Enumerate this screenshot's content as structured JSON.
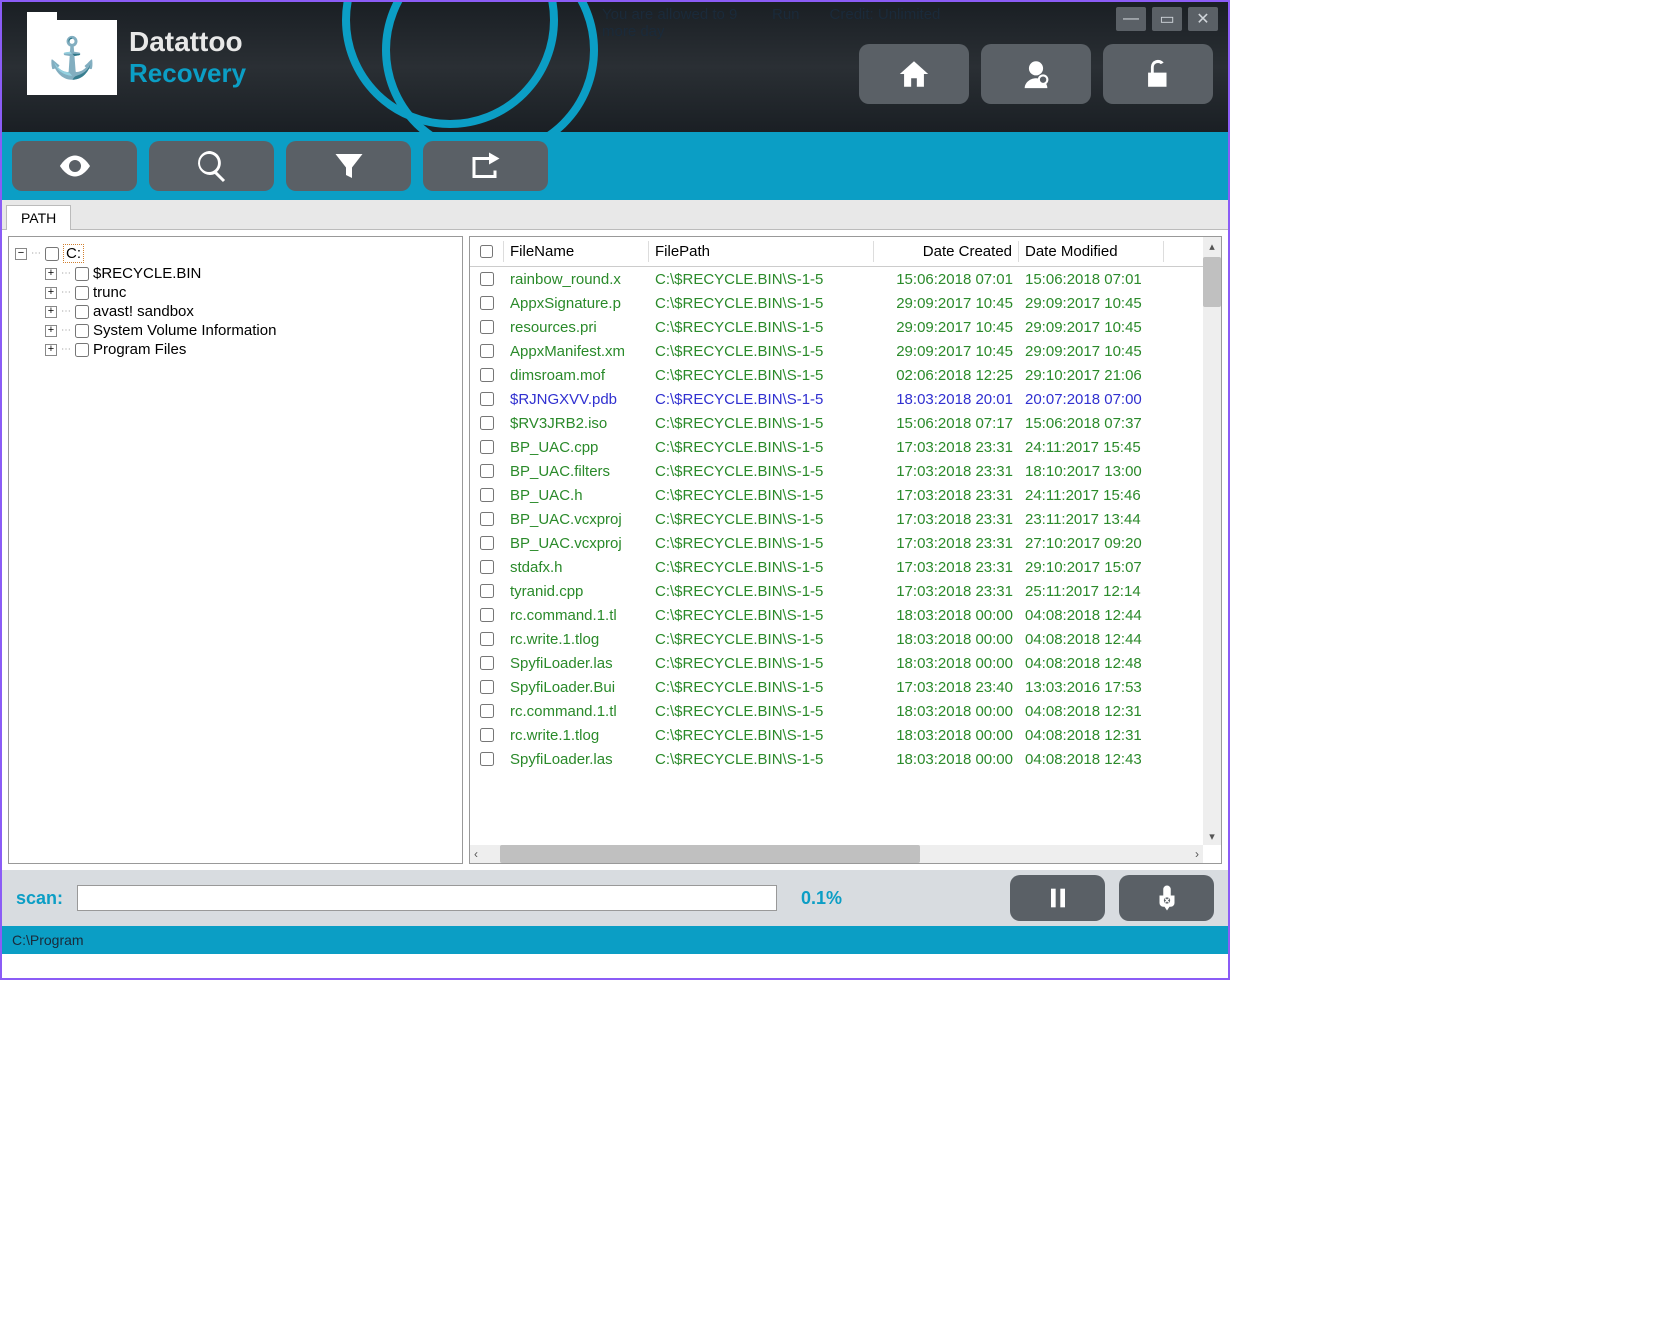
{
  "app": {
    "title1": "Datattoo",
    "title2": "Recovery"
  },
  "top_info": {
    "trial": "You are allowed to 9 more day",
    "run": "Run",
    "credit": "Credit: Unlimited"
  },
  "tab": {
    "label": "PATH"
  },
  "tree": {
    "root": "C:",
    "children": [
      "$RECYCLE.BIN",
      "trunc",
      "avast! sandbox",
      "System Volume Information",
      "Program Files"
    ]
  },
  "columns": {
    "filename": "FileName",
    "filepath": "FilePath",
    "created": "Date Created",
    "modified": "Date Modified"
  },
  "rows": [
    {
      "fn": "rainbow_round.x",
      "fp": "C:\\$RECYCLE.BIN\\S-1-5",
      "dc": "15:06:2018 07:01",
      "dm": "15:06:2018 07:01",
      "style": "green"
    },
    {
      "fn": "AppxSignature.p",
      "fp": "C:\\$RECYCLE.BIN\\S-1-5",
      "dc": "29:09:2017 10:45",
      "dm": "29:09:2017 10:45",
      "style": "green"
    },
    {
      "fn": "resources.pri",
      "fp": "C:\\$RECYCLE.BIN\\S-1-5",
      "dc": "29:09:2017 10:45",
      "dm": "29:09:2017 10:45",
      "style": "green"
    },
    {
      "fn": "AppxManifest.xm",
      "fp": "C:\\$RECYCLE.BIN\\S-1-5",
      "dc": "29:09:2017 10:45",
      "dm": "29:09:2017 10:45",
      "style": "green"
    },
    {
      "fn": "dimsroam.mof",
      "fp": "C:\\$RECYCLE.BIN\\S-1-5",
      "dc": "02:06:2018 12:25",
      "dm": "29:10:2017 21:06",
      "style": "green"
    },
    {
      "fn": "$RJNGXVV.pdb",
      "fp": "C:\\$RECYCLE.BIN\\S-1-5",
      "dc": "18:03:2018 20:01",
      "dm": "20:07:2018 07:00",
      "style": "blue"
    },
    {
      "fn": "$RV3JRB2.iso",
      "fp": "C:\\$RECYCLE.BIN\\S-1-5",
      "dc": "15:06:2018 07:17",
      "dm": "15:06:2018 07:37",
      "style": "green"
    },
    {
      "fn": "BP_UAC.cpp",
      "fp": "C:\\$RECYCLE.BIN\\S-1-5",
      "dc": "17:03:2018 23:31",
      "dm": "24:11:2017 15:45",
      "style": "green"
    },
    {
      "fn": "BP_UAC.filters",
      "fp": "C:\\$RECYCLE.BIN\\S-1-5",
      "dc": "17:03:2018 23:31",
      "dm": "18:10:2017 13:00",
      "style": "green"
    },
    {
      "fn": "BP_UAC.h",
      "fp": "C:\\$RECYCLE.BIN\\S-1-5",
      "dc": "17:03:2018 23:31",
      "dm": "24:11:2017 15:46",
      "style": "green"
    },
    {
      "fn": "BP_UAC.vcxproj",
      "fp": "C:\\$RECYCLE.BIN\\S-1-5",
      "dc": "17:03:2018 23:31",
      "dm": "23:11:2017 13:44",
      "style": "green"
    },
    {
      "fn": "BP_UAC.vcxproj",
      "fp": "C:\\$RECYCLE.BIN\\S-1-5",
      "dc": "17:03:2018 23:31",
      "dm": "27:10:2017 09:20",
      "style": "green"
    },
    {
      "fn": "stdafx.h",
      "fp": "C:\\$RECYCLE.BIN\\S-1-5",
      "dc": "17:03:2018 23:31",
      "dm": "29:10:2017 15:07",
      "style": "green"
    },
    {
      "fn": "tyranid.cpp",
      "fp": "C:\\$RECYCLE.BIN\\S-1-5",
      "dc": "17:03:2018 23:31",
      "dm": "25:11:2017 12:14",
      "style": "green"
    },
    {
      "fn": "rc.command.1.tl",
      "fp": "C:\\$RECYCLE.BIN\\S-1-5",
      "dc": "18:03:2018 00:00",
      "dm": "04:08:2018 12:44",
      "style": "green"
    },
    {
      "fn": "rc.write.1.tlog",
      "fp": "C:\\$RECYCLE.BIN\\S-1-5",
      "dc": "18:03:2018 00:00",
      "dm": "04:08:2018 12:44",
      "style": "green"
    },
    {
      "fn": "SpyfiLoader.las",
      "fp": "C:\\$RECYCLE.BIN\\S-1-5",
      "dc": "18:03:2018 00:00",
      "dm": "04:08:2018 12:48",
      "style": "green"
    },
    {
      "fn": "SpyfiLoader.Bui",
      "fp": "C:\\$RECYCLE.BIN\\S-1-5",
      "dc": "17:03:2018 23:40",
      "dm": "13:03:2016 17:53",
      "style": "green"
    },
    {
      "fn": "rc.command.1.tl",
      "fp": "C:\\$RECYCLE.BIN\\S-1-5",
      "dc": "18:03:2018 00:00",
      "dm": "04:08:2018 12:31",
      "style": "green"
    },
    {
      "fn": "rc.write.1.tlog",
      "fp": "C:\\$RECYCLE.BIN\\S-1-5",
      "dc": "18:03:2018 00:00",
      "dm": "04:08:2018 12:31",
      "style": "green"
    },
    {
      "fn": "SpyfiLoader.las",
      "fp": "C:\\$RECYCLE.BIN\\S-1-5",
      "dc": "18:03:2018 00:00",
      "dm": "04:08:2018 12:43",
      "style": "green"
    }
  ],
  "scan": {
    "label": "scan:",
    "percent": "0.1%"
  },
  "status": "C:\\Program"
}
